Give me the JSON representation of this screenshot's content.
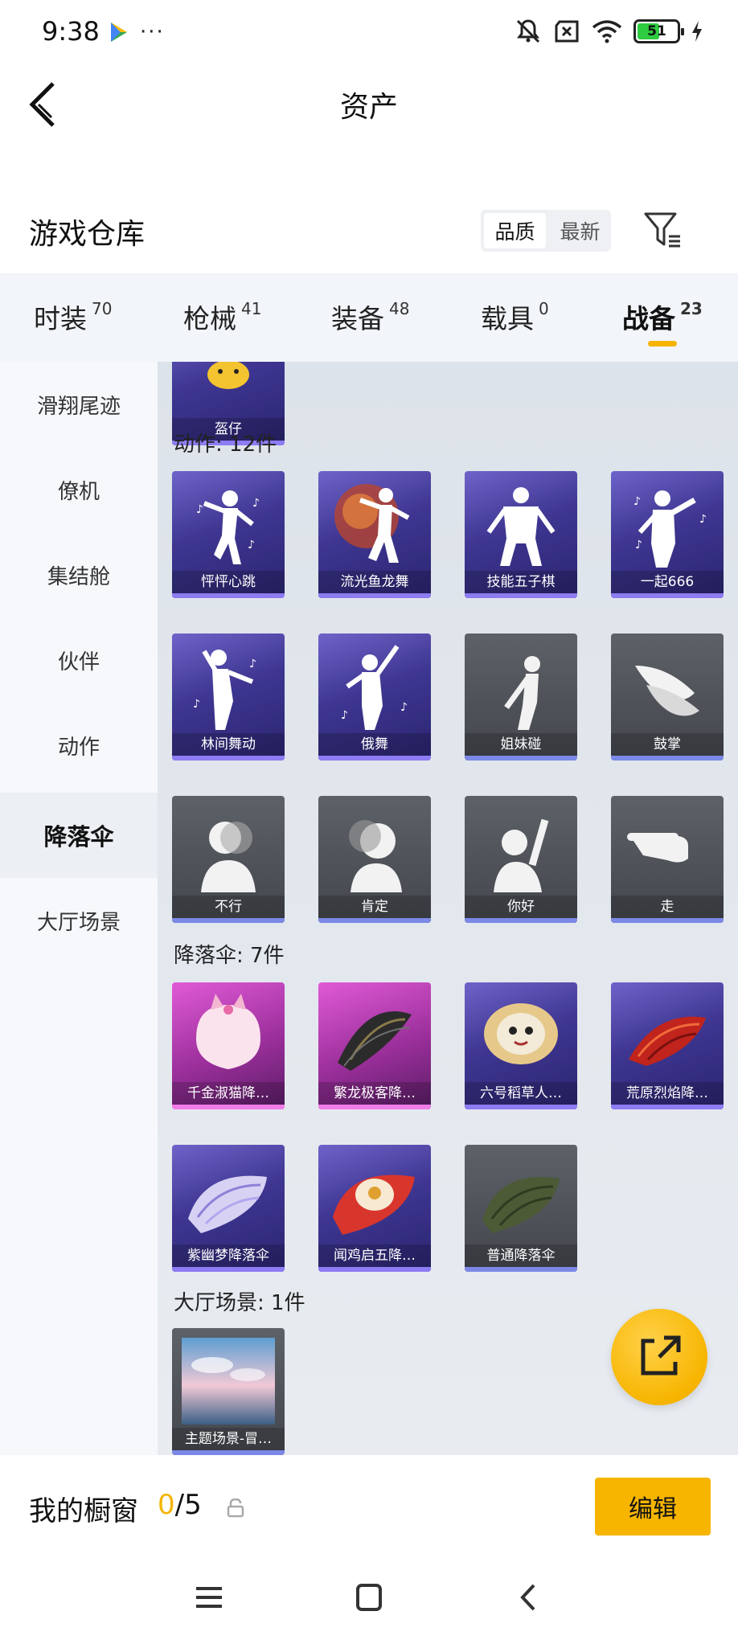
{
  "status_bar": {
    "time": "9:38",
    "dots": "···",
    "battery_level": "51"
  },
  "header": {
    "title": "资产"
  },
  "warehouse": {
    "title": "游戏仓库",
    "sort_options": [
      "品质",
      "最新"
    ],
    "active_sort": "品质"
  },
  "tabs": [
    {
      "label": "时装",
      "count": "70"
    },
    {
      "label": "枪械",
      "count": "41"
    },
    {
      "label": "装备",
      "count": "48"
    },
    {
      "label": "载具",
      "count": "0"
    },
    {
      "label": "战备",
      "count": "23"
    }
  ],
  "active_tab": "战备",
  "sidebar": {
    "items": [
      "滑翔尾迹",
      "僚机",
      "集结舱",
      "伙伴",
      "动作",
      "降落伞",
      "大厅场景"
    ],
    "active": "降落伞"
  },
  "content": {
    "top_partial": {
      "name": "盔仔"
    },
    "sections": [
      {
        "label": "动作: 12件",
        "items": [
          {
            "name": "怦怦心跳",
            "style": "purple"
          },
          {
            "name": "流光鱼龙舞",
            "style": "purple"
          },
          {
            "name": "技能五子棋",
            "style": "purple"
          },
          {
            "name": "一起666",
            "style": "purple"
          },
          {
            "name": "林间舞动",
            "style": "purple"
          },
          {
            "name": "俄舞",
            "style": "purple"
          },
          {
            "name": "姐妹碰",
            "style": "gray"
          },
          {
            "name": "鼓掌",
            "style": "gray"
          },
          {
            "name": "不行",
            "style": "gray"
          },
          {
            "name": "肯定",
            "style": "gray"
          },
          {
            "name": "你好",
            "style": "gray"
          },
          {
            "name": "走",
            "style": "gray"
          }
        ]
      },
      {
        "label": "降落伞: 7件",
        "items": [
          {
            "name": "千金淑猫降…",
            "style": "pink"
          },
          {
            "name": "繁龙极客降…",
            "style": "pink"
          },
          {
            "name": "六号稻草人…",
            "style": "purple"
          },
          {
            "name": "荒原烈焰降…",
            "style": "purple"
          },
          {
            "name": "紫幽梦降落伞",
            "style": "purple"
          },
          {
            "name": "闻鸡启五降…",
            "style": "purple"
          },
          {
            "name": "普通降落伞",
            "style": "gray"
          }
        ]
      },
      {
        "label": "大厅场景: 1件",
        "items": [
          {
            "name": "主题场景-冒…",
            "style": "gray"
          }
        ]
      }
    ]
  },
  "showcase": {
    "title": "我的橱窗",
    "current": "0",
    "max": "/5",
    "edit_label": "编辑"
  },
  "colors": {
    "accent": "#f7b500",
    "purple_card": "#3e3691",
    "gray_card": "#4c5056",
    "pink_card": "#b63cb3"
  }
}
